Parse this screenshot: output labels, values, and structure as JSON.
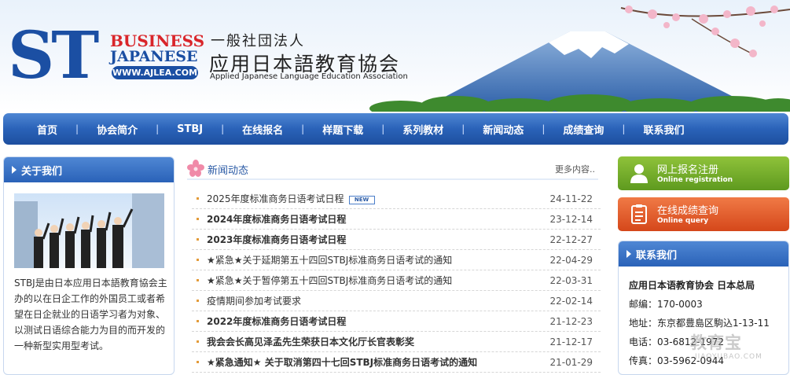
{
  "header": {
    "logo_st": "ST",
    "logo_business": "BUSINESS",
    "logo_japanese": "JAPANESE",
    "logo_url": "WWW.AJLEA.COM",
    "org_line1": "一般社団法人",
    "org_line2": "应用日本語教育協会",
    "org_line3": "Applied Japanese Language Education Association"
  },
  "nav": {
    "items": [
      {
        "label": "首页"
      },
      {
        "label": "协会简介"
      },
      {
        "label": "STBJ"
      },
      {
        "label": "在线报名"
      },
      {
        "label": "样题下载"
      },
      {
        "label": "系列教材"
      },
      {
        "label": "新闻动态"
      },
      {
        "label": "成绩查询"
      },
      {
        "label": "联系我们"
      }
    ],
    "separator": "|"
  },
  "about": {
    "title": "关于我们",
    "text": "STBJ是由日本应用日本語教育協会主办的以在日企工作的外国员工或者希望在日企就业的日语学习者为对象、以测试日语综合能力为目的而开发的一种新型实用型考试。"
  },
  "news": {
    "title": "新闻动态",
    "more": "更多内容..",
    "new_badge": "NEW",
    "items": [
      {
        "title": "2025年度标准商务日语考试日程",
        "date": "24-11-22",
        "bold": false,
        "new": true
      },
      {
        "title": "2024年度标准商务日语考试日程",
        "date": "23-12-14",
        "bold": true,
        "new": false
      },
      {
        "title": "2023年度标准商务日语考试日程",
        "date": "22-12-27",
        "bold": true,
        "new": false
      },
      {
        "title": "★紧急★关于延期第五十四回STBJ标准商务日语考试的通知",
        "date": "22-04-29",
        "bold": false,
        "new": false
      },
      {
        "title": "★紧急★关于暂停第五十四回STBJ标准商务日语考试的通知",
        "date": "22-03-31",
        "bold": false,
        "new": false
      },
      {
        "title": "疫情期间参加考试要求",
        "date": "22-02-14",
        "bold": false,
        "new": false
      },
      {
        "title": "2022年度标准商务日语考试日程",
        "date": "21-12-23",
        "bold": true,
        "new": false
      },
      {
        "title": "我会会长高见泽孟先生荣获日本文化厅长官表彰奖",
        "date": "21-12-17",
        "bold": true,
        "new": false
      },
      {
        "title": "★紧急通知★ 关于取消第四十七回STBJ标准商务日语考试的通知",
        "date": "21-01-29",
        "bold": true,
        "new": false
      }
    ]
  },
  "right": {
    "register": {
      "main": "网上报名注册",
      "sub": "Online registration"
    },
    "query": {
      "main": "在线成绩查询",
      "sub": "Online query"
    },
    "contact": {
      "title": "联系我们",
      "org": "应用日本语教育协会 日本总局",
      "zip": "邮编：170-0003",
      "address": "地址：东京都豊島区駒込1-13-11",
      "phone": "电话：03-6812-1972",
      "fax": "传真：03-5962-0944"
    }
  },
  "watermark": {
    "main": "教育宝",
    "sub": "JIAOYUBAO.COM"
  },
  "colors": {
    "brand_blue": "#1b4fa3",
    "brand_red": "#d9252a",
    "nav_blue": "#2a62b8",
    "green": "#6aa824",
    "orange": "#e25c2a"
  }
}
